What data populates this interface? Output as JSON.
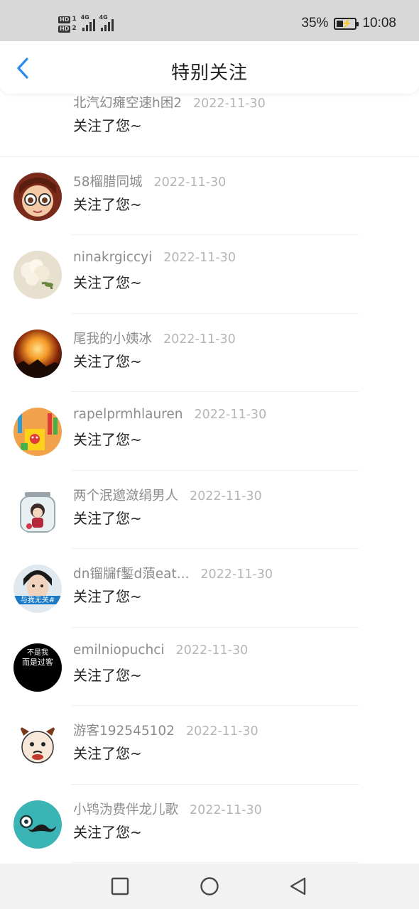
{
  "status_bar": {
    "network_label": "4G",
    "battery": "35%",
    "battery_level": 0.35,
    "time": "10:08"
  },
  "header": {
    "title": "特别关注",
    "back_icon": "chevron-left-icon",
    "accent_color": "#2d8cf0"
  },
  "items": [
    {
      "name": "北汽幻瘫空速h困2",
      "date": "2022-11-30",
      "message": "关注了您~",
      "avatar": "none"
    },
    {
      "name": "58榴腊同城",
      "date": "2022-11-30",
      "message": "关注了您~",
      "avatar": "anime-girl-glasses"
    },
    {
      "name": "ninakrgiccyi",
      "date": "2022-11-30",
      "message": "关注了您~",
      "avatar": "flowers"
    },
    {
      "name": "尾我的小姨冰",
      "date": "2022-11-30",
      "message": "关注了您~",
      "avatar": "sunset-fire"
    },
    {
      "name": "rapelprmhlauren",
      "date": "2022-11-30",
      "message": "关注了您~",
      "avatar": "colorful-toys"
    },
    {
      "name": "两个泯邈潋绢男人",
      "date": "2022-11-30",
      "message": "关注了您~",
      "avatar": "girl-in-jar"
    },
    {
      "name": "dn镏牖f鏨d蒗eat...",
      "date": "2022-11-30",
      "message": "关注了您~",
      "avatar": "boy-photo"
    },
    {
      "name": "emilniopuchci",
      "date": "2022-11-30",
      "message": "关注了您~",
      "avatar": "black-text"
    },
    {
      "name": "游客192545102",
      "date": "2022-11-30",
      "message": "关注了您~",
      "avatar": "cartoon-dog"
    },
    {
      "name": "小鸨沩费伴龙儿歌",
      "date": "2022-11-30",
      "message": "关注了您~",
      "avatar": "teal-mustache"
    }
  ],
  "avatar_text": {
    "boy_photo": "与我无关#",
    "black_line1": "不是我",
    "black_line2": "而是过客"
  },
  "nav_bar": {
    "recent_icon": "square-icon",
    "home_icon": "circle-icon",
    "back_icon": "triangle-back-icon"
  }
}
